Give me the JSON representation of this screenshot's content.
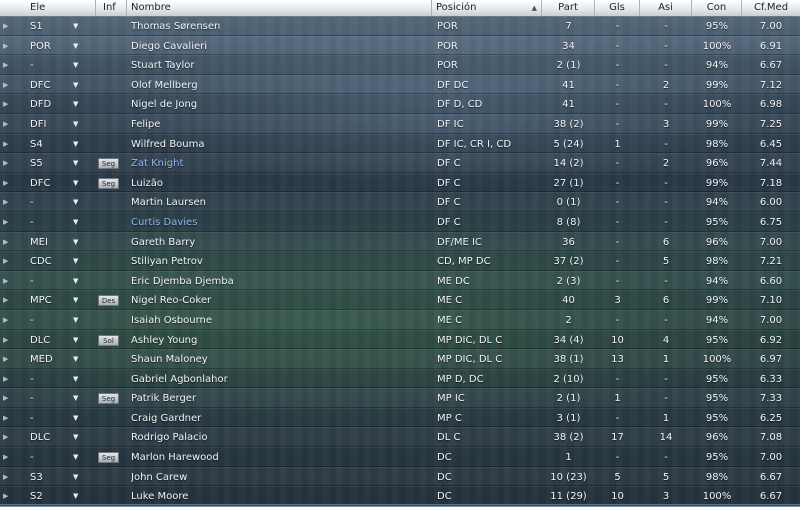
{
  "columns": {
    "ele": "Ele",
    "inf": "Inf",
    "nombre": "Nombre",
    "posicion": "Posición",
    "part": "Part",
    "gls": "Gls",
    "asi": "Asi",
    "con": "Con",
    "cfmed": "Cf.Med"
  },
  "sort_icon": "triangle-up",
  "colors": {
    "link_name": "#8fb6f5",
    "header_bg": "#e6e9ec",
    "row_text": "#f2f5f8"
  },
  "players": [
    {
      "ele": "S1",
      "inf": "",
      "name": "Thomas Sørensen",
      "pos": "POR",
      "part": "7",
      "gls": "-",
      "asi": "-",
      "con": "95%",
      "cf": "7.00",
      "link": false
    },
    {
      "ele": "POR",
      "inf": "",
      "name": "Diego Cavalieri",
      "pos": "POR",
      "part": "34",
      "gls": "-",
      "asi": "-",
      "con": "100%",
      "cf": "6.91",
      "link": false
    },
    {
      "ele": "-",
      "inf": "",
      "name": "Stuart Taylor",
      "pos": "POR",
      "part": "2 (1)",
      "gls": "-",
      "asi": "-",
      "con": "94%",
      "cf": "6.67",
      "link": false
    },
    {
      "ele": "DFC",
      "inf": "",
      "name": "Olof Mellberg",
      "pos": "DF DC",
      "part": "41",
      "gls": "-",
      "asi": "2",
      "con": "99%",
      "cf": "7.12",
      "link": false
    },
    {
      "ele": "DFD",
      "inf": "",
      "name": "Nigel de Jong",
      "pos": "DF D, CD",
      "part": "41",
      "gls": "-",
      "asi": "-",
      "con": "100%",
      "cf": "6.98",
      "link": false
    },
    {
      "ele": "DFI",
      "inf": "",
      "name": "Felipe",
      "pos": "DF IC",
      "part": "38 (2)",
      "gls": "-",
      "asi": "3",
      "con": "99%",
      "cf": "7.25",
      "link": false
    },
    {
      "ele": "S4",
      "inf": "",
      "name": "Wilfred Bouma",
      "pos": "DF IC, CR I, CD",
      "part": "5 (24)",
      "gls": "1",
      "asi": "-",
      "con": "98%",
      "cf": "6.45",
      "link": false
    },
    {
      "ele": "S5",
      "inf": "Seg",
      "name": "Zat Knight",
      "pos": "DF C",
      "part": "14 (2)",
      "gls": "-",
      "asi": "2",
      "con": "96%",
      "cf": "7.44",
      "link": true
    },
    {
      "ele": "DFC",
      "inf": "Seg",
      "name": "Luizão",
      "pos": "DF C",
      "part": "27 (1)",
      "gls": "-",
      "asi": "-",
      "con": "99%",
      "cf": "7.18",
      "link": false
    },
    {
      "ele": "-",
      "inf": "",
      "name": "Martin Laursen",
      "pos": "DF C",
      "part": "0 (1)",
      "gls": "-",
      "asi": "-",
      "con": "94%",
      "cf": "6.00",
      "link": false
    },
    {
      "ele": "-",
      "inf": "",
      "name": "Curtis Davies",
      "pos": "DF C",
      "part": "8 (8)",
      "gls": "-",
      "asi": "-",
      "con": "95%",
      "cf": "6.75",
      "link": true
    },
    {
      "ele": "MEI",
      "inf": "",
      "name": "Gareth Barry",
      "pos": "DF/ME IC",
      "part": "36",
      "gls": "-",
      "asi": "6",
      "con": "96%",
      "cf": "7.00",
      "link": false
    },
    {
      "ele": "CDC",
      "inf": "",
      "name": "Stiliyan Petrov",
      "pos": "CD, MP DC",
      "part": "37 (2)",
      "gls": "-",
      "asi": "5",
      "con": "98%",
      "cf": "7.21",
      "link": false
    },
    {
      "ele": "-",
      "inf": "",
      "name": "Eric Djemba Djemba",
      "pos": "ME DC",
      "part": "2 (3)",
      "gls": "-",
      "asi": "-",
      "con": "94%",
      "cf": "6.60",
      "link": false
    },
    {
      "ele": "MPC",
      "inf": "Des",
      "name": "Nigel Reo-Coker",
      "pos": "ME C",
      "part": "40",
      "gls": "3",
      "asi": "6",
      "con": "99%",
      "cf": "7.10",
      "link": false
    },
    {
      "ele": "-",
      "inf": "",
      "name": "Isaiah Osbourne",
      "pos": "ME C",
      "part": "2",
      "gls": "-",
      "asi": "-",
      "con": "94%",
      "cf": "7.00",
      "link": false
    },
    {
      "ele": "DLC",
      "inf": "Sol",
      "name": "Ashley Young",
      "pos": "MP DIC, DL C",
      "part": "34 (4)",
      "gls": "10",
      "asi": "4",
      "con": "95%",
      "cf": "6.92",
      "link": false
    },
    {
      "ele": "MED",
      "inf": "",
      "name": "Shaun Maloney",
      "pos": "MP DIC, DL C",
      "part": "38 (1)",
      "gls": "13",
      "asi": "1",
      "con": "100%",
      "cf": "6.97",
      "link": false
    },
    {
      "ele": "-",
      "inf": "",
      "name": "Gabriel Agbonlahor",
      "pos": "MP D, DC",
      "part": "2 (10)",
      "gls": "-",
      "asi": "-",
      "con": "95%",
      "cf": "6.33",
      "link": false
    },
    {
      "ele": "-",
      "inf": "Seg",
      "name": "Patrik Berger",
      "pos": "MP IC",
      "part": "2 (1)",
      "gls": "1",
      "asi": "-",
      "con": "95%",
      "cf": "7.33",
      "link": false
    },
    {
      "ele": "-",
      "inf": "",
      "name": "Craig Gardner",
      "pos": "MP C",
      "part": "3 (1)",
      "gls": "-",
      "asi": "1",
      "con": "95%",
      "cf": "6.25",
      "link": false
    },
    {
      "ele": "DLC",
      "inf": "",
      "name": "Rodrigo Palacio",
      "pos": "DL C",
      "part": "38 (2)",
      "gls": "17",
      "asi": "14",
      "con": "96%",
      "cf": "7.08",
      "link": false
    },
    {
      "ele": "-",
      "inf": "Seg",
      "name": "Marlon Harewood",
      "pos": "DC",
      "part": "1",
      "gls": "-",
      "asi": "-",
      "con": "95%",
      "cf": "7.00",
      "link": false
    },
    {
      "ele": "S3",
      "inf": "",
      "name": "John Carew",
      "pos": "DC",
      "part": "10 (23)",
      "gls": "5",
      "asi": "5",
      "con": "98%",
      "cf": "6.67",
      "link": false
    },
    {
      "ele": "S2",
      "inf": "",
      "name": "Luke Moore",
      "pos": "DC",
      "part": "11 (29)",
      "gls": "10",
      "asi": "3",
      "con": "100%",
      "cf": "6.67",
      "link": false
    }
  ]
}
